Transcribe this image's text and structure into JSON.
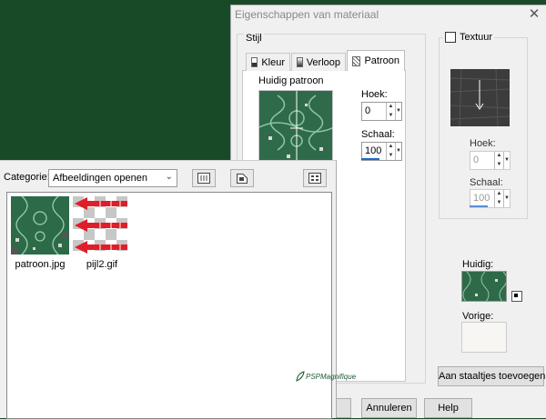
{
  "dialog": {
    "title": "Eigenschappen van materiaal",
    "close": "✕",
    "style_label": "Stijl",
    "tabs": [
      {
        "label": "Kleur"
      },
      {
        "label": "Verloop"
      },
      {
        "label": "Patroon"
      }
    ],
    "current_pattern_label": "Huidig patroon",
    "angle_label": "Hoek:",
    "angle_value": "0",
    "scale_label": "Schaal:",
    "scale_value": "100",
    "texture_label": "Textuur",
    "tex_angle_label": "Hoek:",
    "tex_angle_value": "0",
    "tex_scale_label": "Schaal:",
    "tex_scale_value": "100",
    "current_label": "Huidig:",
    "previous_label": "Vorige:",
    "add_swatch_button": "Aan staaltjes toevoegen...",
    "cancel_button": "Annuleren",
    "help_button": "Help"
  },
  "open_panel": {
    "category_label": "Categorie:",
    "category_value": "Afbeeldingen openen",
    "files": [
      {
        "name": "patroon.jpg"
      },
      {
        "name": "pijl2.gif"
      }
    ],
    "watermark": "PSPMagnifique"
  },
  "colors": {
    "background": "#184a28",
    "pattern_green": "#2d6a47",
    "accent_blue": "#1c6ac9",
    "arrow_red": "#e01e2a"
  }
}
